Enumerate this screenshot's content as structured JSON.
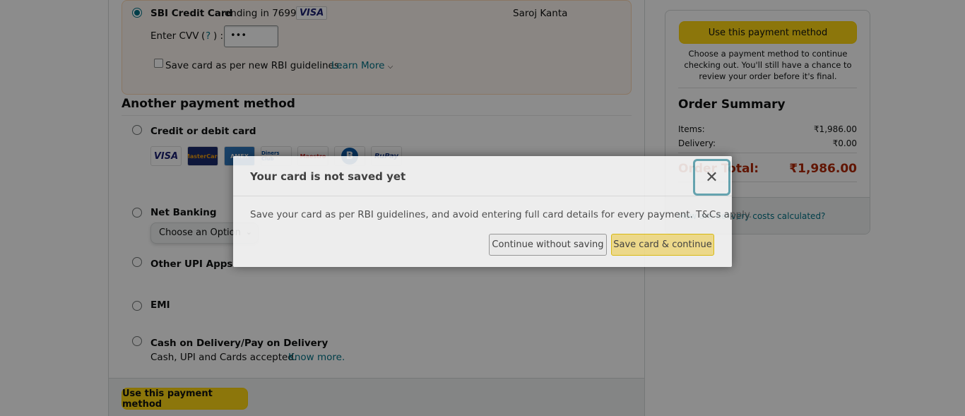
{
  "selected_card": {
    "bank_name": "SBI Credit Card",
    "ending_text": "ending in 7699",
    "network": "VISA",
    "holder": "Saroj Kanta",
    "cvv_label": "Enter CVV",
    "cvv_help_open": "(",
    "cvv_help": "?",
    "cvv_help_close": ") :",
    "cvv_value": "•••",
    "save_card_label": "Save card as per new RBI guidelines.",
    "learn_more": "Learn More"
  },
  "another_method": {
    "title": "Another payment method",
    "options": [
      {
        "label": "Credit or debit card"
      },
      {
        "label": "Net Banking"
      },
      {
        "label": "Other UPI Apps"
      },
      {
        "label": "EMI"
      },
      {
        "label": "Cash on Delivery/Pay on Delivery"
      }
    ],
    "card_logos": [
      "VISA",
      "MasterCard",
      "AMEX",
      "Diners Club",
      "Maestro",
      "B",
      "RuPay"
    ],
    "netbanking_select": "Choose an Option",
    "cod_subtext": "Cash, UPI and Cards accepted.",
    "cod_link": "Know more."
  },
  "footer_button": "Use this payment method",
  "summary": {
    "button": "Use this payment method",
    "note": "Choose a payment method to continue checking out. You'll still have a chance to review your order before it's final.",
    "title": "Order Summary",
    "items_label": "Items:",
    "items_value": "₹1,986.00",
    "delivery_label": "Delivery:",
    "delivery_value": "₹0.00",
    "total_label": "Order Total:",
    "total_value": "₹1,986.00",
    "footer_link": "How are delivery costs calculated?"
  },
  "modal": {
    "title": "Your card is not saved yet",
    "body": "Save your card as per RBI guidelines, and avoid entering full card details for every payment. T&Cs apply.",
    "secondary_button": "Continue without saving",
    "primary_button": "Save card & continue",
    "close_glyph": "✕"
  },
  "colors": {
    "accent_link": "#007185",
    "button_yellow": "#ffd814",
    "total_red": "#b12704"
  }
}
